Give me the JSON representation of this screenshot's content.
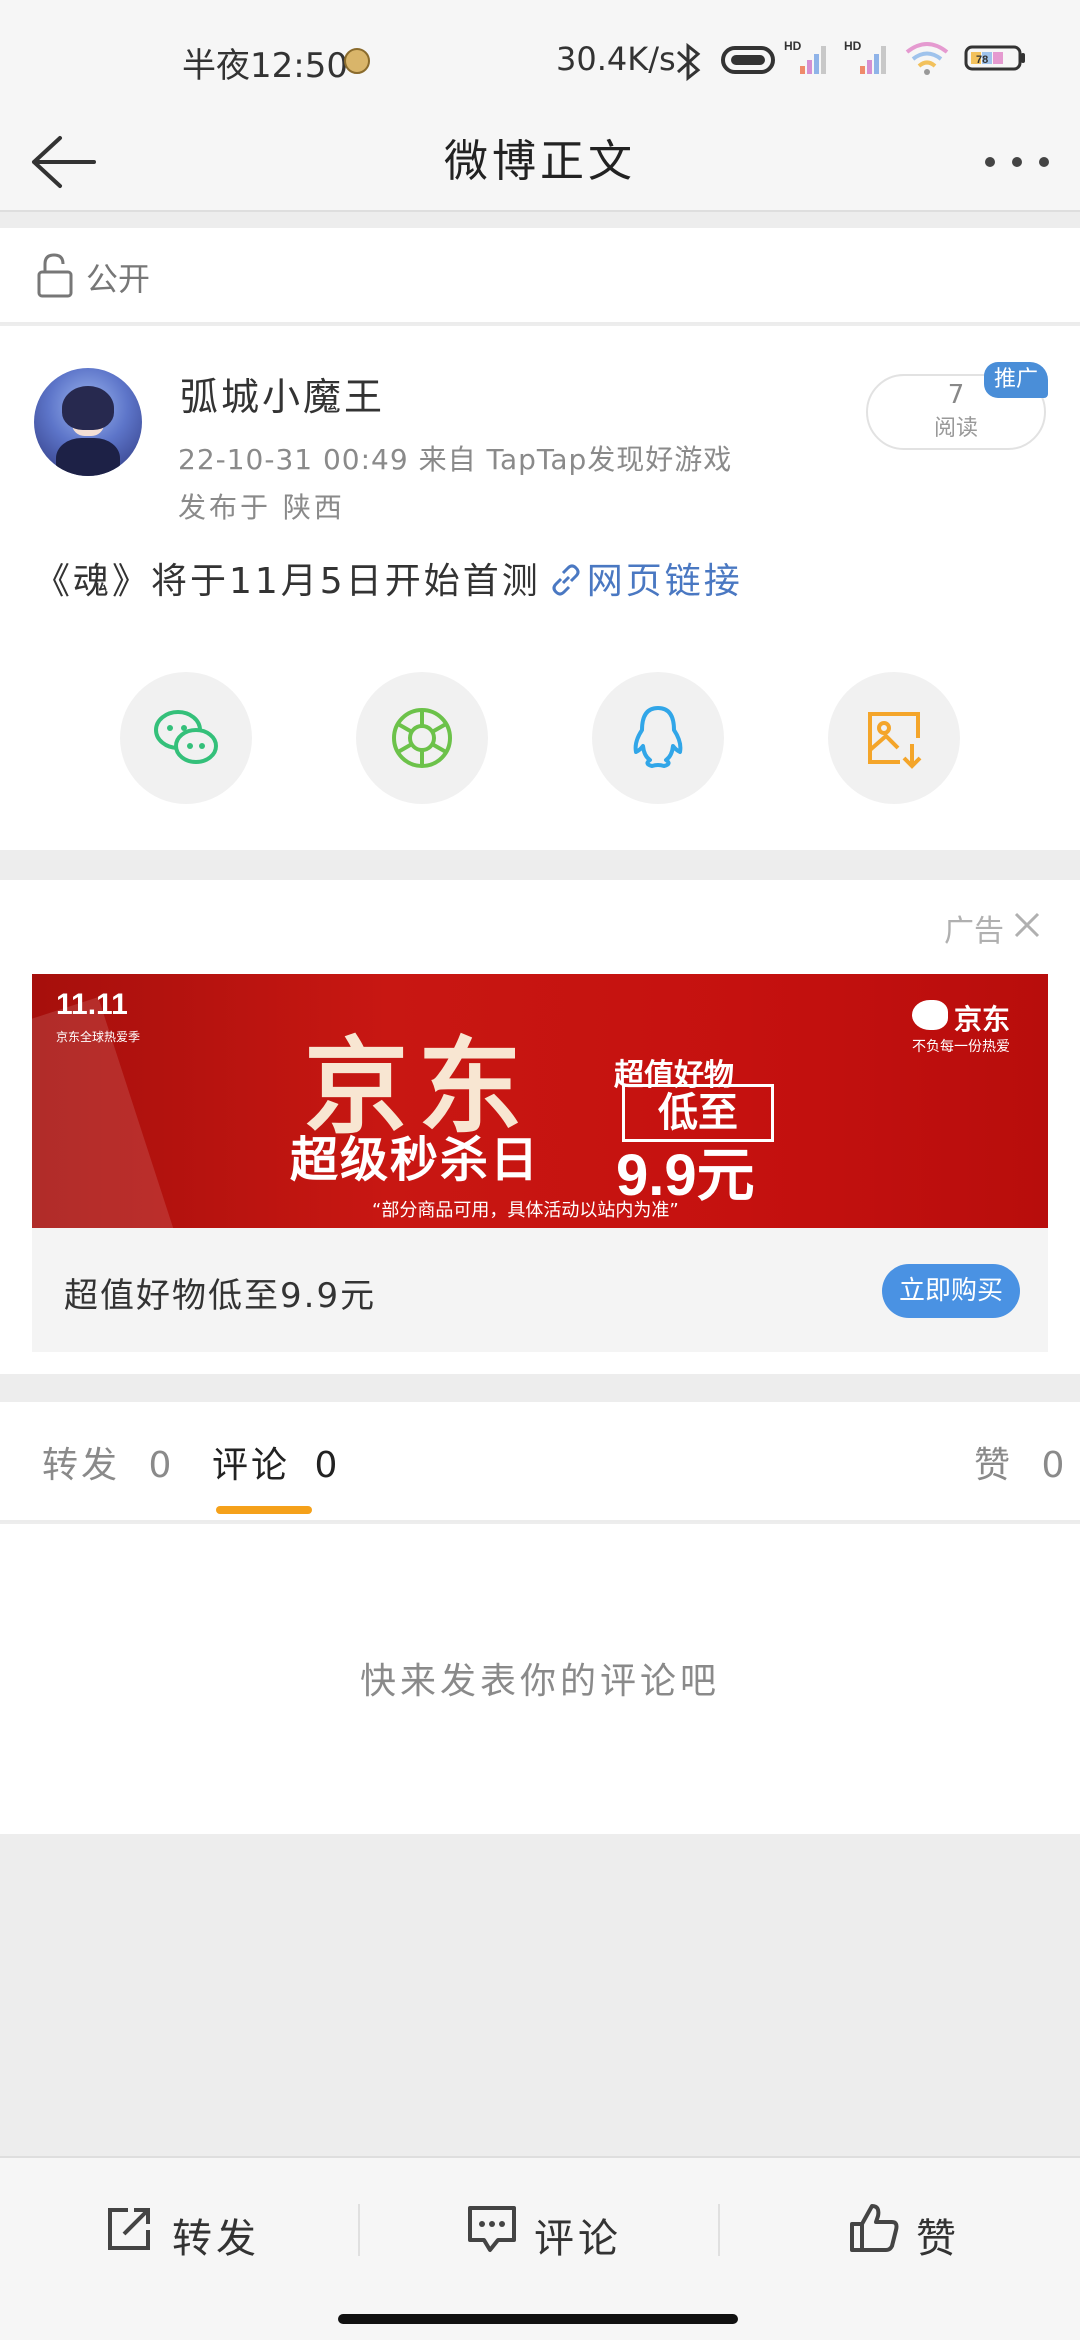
{
  "status_bar": {
    "time": "半夜12:50",
    "net_speed": "30.4K/s",
    "signal_badge_1": "HD",
    "signal_badge_2": "HD",
    "battery_level": "78"
  },
  "nav": {
    "title": "微博正文"
  },
  "visibility": {
    "label": "公开"
  },
  "post": {
    "username": "弧城小魔王",
    "meta": "22-10-31 00:49  来自 TapTap发现好游戏",
    "location": "发布于 陕西",
    "reads_count": "7",
    "reads_label": "阅读",
    "promo_badge": "推广",
    "text": "《魂》将于11月5日开始首测",
    "link_text": "网页链接",
    "share_targets": [
      "wechat-icon",
      "moments-icon",
      "qq-icon",
      "save-image-icon"
    ],
    "colors": {
      "wechat": "#34c07a",
      "moments": "#6cc24a",
      "qq": "#31a6e8",
      "save": "#f4a52a"
    }
  },
  "ad": {
    "tag": "广告",
    "banner": {
      "event_badge": "11.11",
      "event_sub": "京东全球热爱季",
      "headline": "京东",
      "subheadline": "超级秒杀日",
      "value_text": "超值好物",
      "low_text": "低至",
      "price": "9.9元",
      "note": "“部分商品可用，具体活动以站内为准”",
      "brand": "京东",
      "slogan": "不负每一份热爱"
    },
    "footer_text": "超值好物低至9.9元",
    "buy_label": "立即购买",
    "accent": "#4a92e3"
  },
  "tabs": [
    {
      "label": "转发",
      "count": "0"
    },
    {
      "label": "评论",
      "count": "0"
    },
    {
      "label": "赞",
      "count": "0"
    }
  ],
  "tab_accent": "#f5a11a",
  "comments": {
    "empty_text": "快来发表你的评论吧"
  },
  "bottom_bar": {
    "repost": "转发",
    "comment": "评论",
    "like": "赞"
  }
}
